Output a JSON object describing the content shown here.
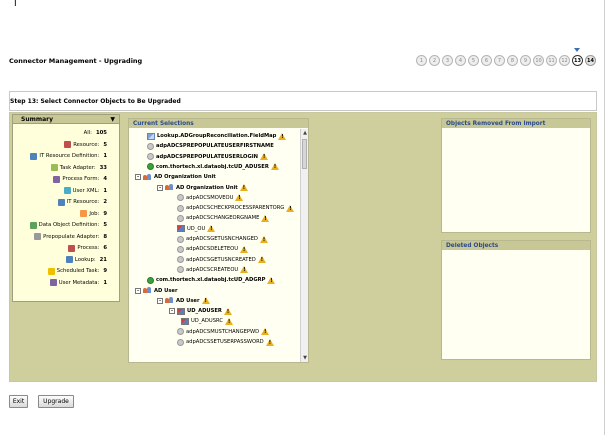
{
  "page": {
    "cursor": "I",
    "title": "Connector Management - Upgrading",
    "step_header": "Step 13: Select Connector Objects to Be Upgraded"
  },
  "stepper": {
    "steps": [
      "1",
      "2",
      "3",
      "4",
      "5",
      "6",
      "7",
      "8",
      "9",
      "10",
      "11",
      "12",
      "13",
      "14"
    ],
    "current": "13"
  },
  "summary": {
    "title": "Summary",
    "collapse_icon": "triangle-down-icon",
    "rows": [
      {
        "label": "All:",
        "count": "105",
        "icon": ""
      },
      {
        "label": "Resource:",
        "count": "5",
        "icon": "resource-icon"
      },
      {
        "label": "IT Resource Definition:",
        "count": "1",
        "icon": "it-resource-def-icon"
      },
      {
        "label": "Task Adapter:",
        "count": "33",
        "icon": "task-adapter-icon"
      },
      {
        "label": "Process Form:",
        "count": "4",
        "icon": "process-form-icon"
      },
      {
        "label": "User XML:",
        "count": "1",
        "icon": "xml-icon"
      },
      {
        "label": "IT Resource:",
        "count": "2",
        "icon": "it-resource-icon"
      },
      {
        "label": "Job:",
        "count": "9",
        "icon": "job-icon"
      },
      {
        "label": "Data Object Definition:",
        "count": "5",
        "icon": "data-object-icon"
      },
      {
        "label": "Prepopulate Adapter:",
        "count": "8",
        "icon": "prepopulate-icon"
      },
      {
        "label": "Process:",
        "count": "6",
        "icon": "process-icon"
      },
      {
        "label": "Lookup:",
        "count": "21",
        "icon": "lookup-icon"
      },
      {
        "label": "Scheduled Task:",
        "count": "9",
        "icon": "scheduled-task-icon"
      },
      {
        "label": "User Metadata:",
        "count": "1",
        "icon": "user-metadata-icon"
      }
    ]
  },
  "current_selections": {
    "title": "Current Selections",
    "nodes": [
      {
        "label": "Lookup.ADGroupReconciliation.FieldMap",
        "icon": "lookup",
        "bold": true,
        "warn": true,
        "toggle": ""
      },
      {
        "label": "adpADCSPREPOPULATEUSERFIRSTNAME",
        "icon": "round",
        "bold": true,
        "warn": false,
        "toggle": ""
      },
      {
        "label": "adpADCSPREPOPULATEUSERLOGIN",
        "icon": "round",
        "bold": true,
        "warn": true,
        "toggle": ""
      },
      {
        "label": "com.thortech.xl.dataobj.tcUD_ADUSER",
        "icon": "green",
        "bold": true,
        "warn": true,
        "toggle": ""
      },
      {
        "label": "AD Organization Unit",
        "icon": "people",
        "bold": true,
        "warn": false,
        "toggle": "-"
      },
      {
        "label": "AD Organization Unit",
        "icon": "people",
        "bold": true,
        "warn": true,
        "toggle": "-"
      },
      {
        "label": "adpADCSMOVEOU",
        "icon": "round",
        "bold": false,
        "warn": true,
        "toggle": ""
      },
      {
        "label": "adpADCSCHECKPROCESSPARENTORG",
        "icon": "round",
        "bold": false,
        "warn": true,
        "toggle": ""
      },
      {
        "label": "adpADCSCHANGEORGNAME",
        "icon": "round",
        "bold": false,
        "warn": true,
        "toggle": ""
      },
      {
        "label": "UD_OU",
        "icon": "flag",
        "bold": false,
        "warn": true,
        "toggle": ""
      },
      {
        "label": "adpADCSGETUSNCHANGED",
        "icon": "round",
        "bold": false,
        "warn": true,
        "toggle": ""
      },
      {
        "label": "adpADCSDELETEOU",
        "icon": "round",
        "bold": false,
        "warn": true,
        "toggle": ""
      },
      {
        "label": "adpADCSGETUSNCREATED",
        "icon": "round",
        "bold": false,
        "warn": true,
        "toggle": ""
      },
      {
        "label": "adpADCSCREATEOU",
        "icon": "round",
        "bold": false,
        "warn": true,
        "toggle": ""
      },
      {
        "label": "com.thortech.xl.dataobj.tcUD_ADGRP",
        "icon": "green",
        "bold": true,
        "warn": true,
        "toggle": ""
      },
      {
        "label": "AD User",
        "icon": "people",
        "bold": true,
        "warn": false,
        "toggle": "-"
      },
      {
        "label": "AD User",
        "icon": "people",
        "bold": true,
        "warn": true,
        "toggle": "-"
      },
      {
        "label": "UD_ADUSER",
        "icon": "flag",
        "bold": true,
        "warn": true,
        "toggle": "-"
      },
      {
        "label": "UD_ADUSRC",
        "icon": "flag",
        "bold": false,
        "warn": true,
        "toggle": ""
      },
      {
        "label": "adpADCSMUSTCHANGEPWD",
        "icon": "round",
        "bold": false,
        "warn": true,
        "toggle": ""
      },
      {
        "label": "adpADCSSETUSERPASSWORD",
        "icon": "round",
        "bold": false,
        "warn": true,
        "toggle": ""
      }
    ]
  },
  "removed_panel": {
    "title": "Objects Removed From Import"
  },
  "deleted_panel": {
    "title": "Deleted Objects"
  },
  "buttons": {
    "exit": "Exit",
    "upgrade": "Upgrade"
  }
}
